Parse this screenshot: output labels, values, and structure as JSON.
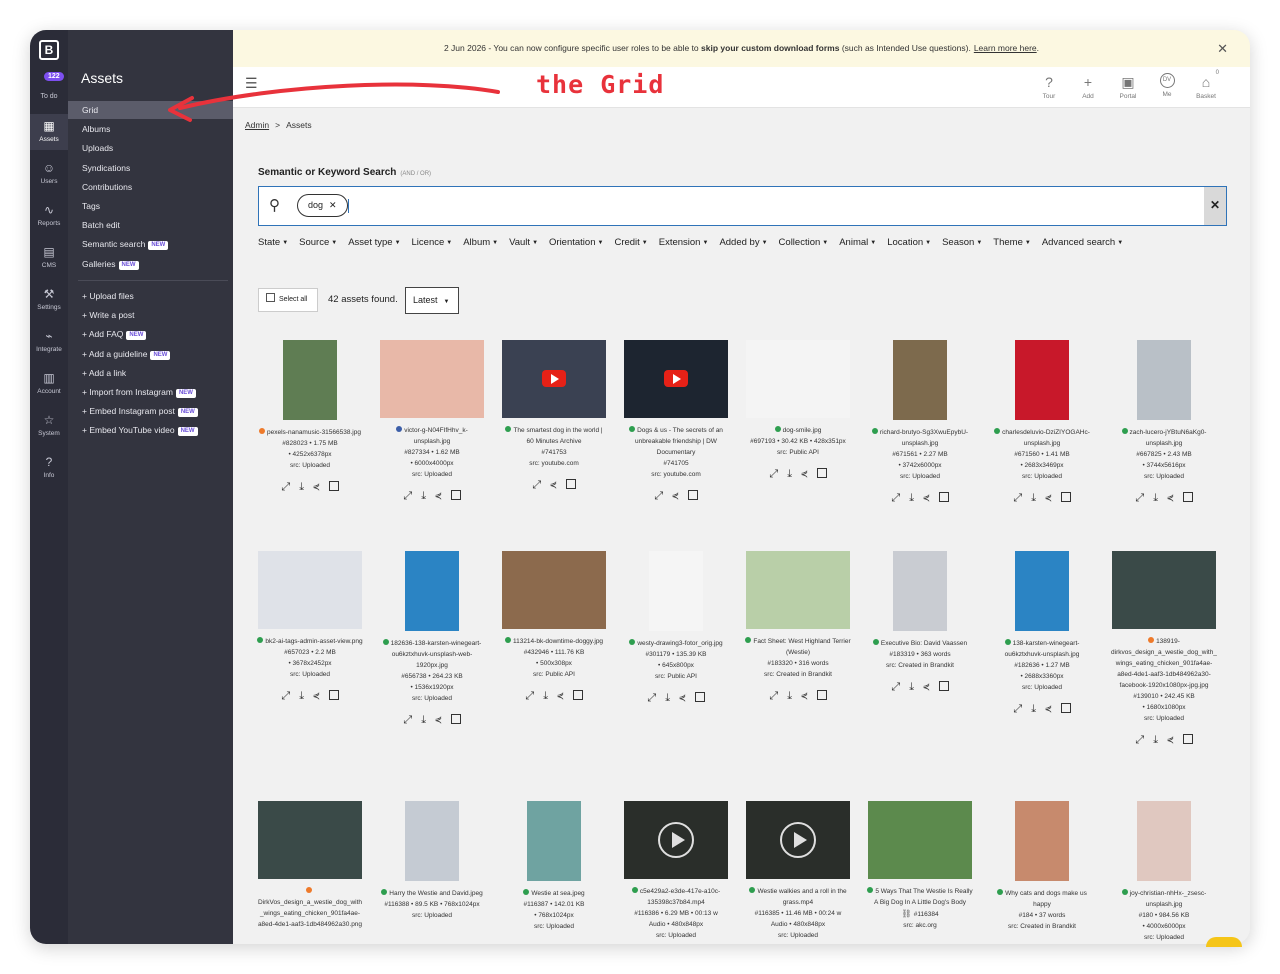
{
  "rail": {
    "logo": "B",
    "todo_count": "122",
    "todo_label": "To do",
    "items": [
      {
        "label": "Assets",
        "icon": "assets-icon",
        "glyph": "▦"
      },
      {
        "label": "Users",
        "icon": "users-icon",
        "glyph": "☺"
      },
      {
        "label": "Reports",
        "icon": "reports-icon",
        "glyph": "∿"
      },
      {
        "label": "CMS",
        "icon": "cms-icon",
        "glyph": "▤"
      },
      {
        "label": "Settings",
        "icon": "wrench-icon",
        "glyph": "⚒"
      },
      {
        "label": "Integrate",
        "icon": "plug-icon",
        "glyph": "⌁"
      },
      {
        "label": "Account",
        "icon": "building-icon",
        "glyph": "▥"
      },
      {
        "label": "System",
        "icon": "star-icon",
        "glyph": "☆"
      },
      {
        "label": "Info",
        "icon": "question-icon",
        "glyph": "?"
      }
    ]
  },
  "subnav": {
    "title": "Assets",
    "items": [
      {
        "label": "Grid"
      },
      {
        "label": "Albums"
      },
      {
        "label": "Uploads"
      },
      {
        "label": "Syndications"
      },
      {
        "label": "Contributions"
      },
      {
        "label": "Tags"
      },
      {
        "label": "Batch edit"
      },
      {
        "label": "Semantic search",
        "badge": "NEW"
      },
      {
        "label": "Galleries",
        "badge": "NEW"
      }
    ],
    "actions": [
      {
        "label": "+ Upload files"
      },
      {
        "label": "+ Write a post"
      },
      {
        "label": "+ Add FAQ",
        "badge": "NEW"
      },
      {
        "label": "+ Add a guideline",
        "badge": "NEW"
      },
      {
        "label": "+ Add a link"
      },
      {
        "label": "+ Import from Instagram",
        "badge": "NEW"
      },
      {
        "label": "+ Embed Instagram post",
        "badge": "NEW"
      },
      {
        "label": "+ Embed YouTube video",
        "badge": "NEW"
      }
    ]
  },
  "banner": {
    "prefix": "2 Jun 2026 - You can now configure specific user roles to be able to",
    "bold": "skip your custom download forms",
    "suffix": "(such as Intended Use questions).",
    "link": "Learn more here",
    "end": "."
  },
  "header": {
    "annotation": "the Grid",
    "icons": [
      {
        "label": "Tour",
        "glyph": "?"
      },
      {
        "label": "Add",
        "glyph": "+"
      },
      {
        "label": "Portal",
        "glyph": "▣"
      },
      {
        "label": "Me",
        "glyph": "DV"
      },
      {
        "label": "Basket",
        "glyph": "⌂",
        "count": "0"
      }
    ]
  },
  "breadcrumb": {
    "root": "Admin",
    "sep": ">",
    "current": "Assets"
  },
  "search": {
    "label": "Semantic or Keyword Search",
    "hint": "(AND / OR)",
    "chip": "dog"
  },
  "filters": [
    "State",
    "Source",
    "Asset type",
    "Licence",
    "Album",
    "Vault",
    "Orientation",
    "Credit",
    "Extension",
    "Added by",
    "Collection",
    "Animal",
    "Location",
    "Season",
    "Theme",
    "Advanced search"
  ],
  "toolbar": {
    "select_all": "Select all",
    "found": "42 assets found.",
    "sort": "Latest"
  },
  "colors": {
    "accent": "#2f73b8",
    "status_green": "#2e9e4f",
    "status_orange": "#ee7a2a",
    "status_blue": "#3c5ea8",
    "annotation_red": "#e8323b"
  },
  "assets": [
    {
      "status": "orange",
      "title": "pexels-nanamusic-31566538.jpg",
      "meta": [
        "#828023 • 1.75 MB",
        "• 4252x6378px",
        "src: Uploaded"
      ],
      "thumb": "tall",
      "bg": "#5f7d53"
    },
    {
      "status": "blue",
      "title": "victor-g-N04FIfHhv_k-unsplash.jpg",
      "meta": [
        "#827334 • 1.62 MB",
        "• 6000x4000px",
        "src: Uploaded"
      ],
      "thumb": "wide",
      "bg": "#e8b8a8"
    },
    {
      "status": "green",
      "title": "The smartest dog in the world | 60 Minutes Archive",
      "yt": "#741753",
      "meta": [
        "src: youtube.com"
      ],
      "thumb": "wide",
      "bg": "#3a4152",
      "video": "yt"
    },
    {
      "status": "green",
      "title": "Dogs & us - The secrets of an unbreakable friendship | DW Documentary",
      "yt": "#741705",
      "meta": [
        "src: youtube.com"
      ],
      "thumb": "wide",
      "bg": "#1d2530",
      "video": "yt"
    },
    {
      "status": "green",
      "title": "dog-smile.jpg",
      "meta": [
        "#697193 • 30.42 KB • 428x351px",
        "src: Public API"
      ],
      "thumb": "wide",
      "bg": "#f4f4f4"
    },
    {
      "status": "green",
      "title": "richard-brutyo-Sg3XwuEpybU-unsplash.jpg",
      "meta": [
        "#671561 • 2.27 MB",
        "• 3742x6000px",
        "src: Uploaded"
      ],
      "thumb": "tall",
      "bg": "#7d6a4d"
    },
    {
      "status": "green",
      "title": "charlesdeluvio-DziZIYOGAHc-unsplash.jpg",
      "meta": [
        "#671560 • 1.41 MB",
        "• 2683x3469px",
        "src: Uploaded"
      ],
      "thumb": "tall",
      "bg": "#c8182a"
    },
    {
      "status": "green",
      "title": "zach-lucero-jYBtuN6aKg0-unsplash.jpg",
      "meta": [
        "#667825 • 2.43 MB",
        "• 3744x5616px",
        "src: Uploaded"
      ],
      "thumb": "tall",
      "bg": "#b9c0c7"
    },
    {
      "status": "green",
      "title": "bk2-ai-tags-admin-asset-view.png",
      "meta": [
        "#657023 • 2.2 MB",
        "• 3678x2452px",
        "src: Uploaded"
      ],
      "thumb": "wide",
      "bg": "#dfe2e8"
    },
    {
      "status": "green",
      "title": "182636-138-karsten-winegeart-ou6kztxhuvk-unsplash-web-1920px.jpg",
      "meta": [
        "#656738 • 264.23 KB",
        "• 1536x1920px",
        "src: Uploaded"
      ],
      "thumb": "tall",
      "bg": "#2b84c4"
    },
    {
      "status": "green",
      "title": "113214-bk-downtime-doggy.jpg",
      "meta": [
        "#432946 • 111.76 KB",
        "• 500x308px",
        "src: Public API"
      ],
      "thumb": "wide",
      "bg": "#8c6a4d"
    },
    {
      "status": "green",
      "title": "westy-drawing3-fotor_orig.jpg",
      "meta": [
        "#301179 • 135.39 KB",
        "• 645x800px",
        "src: Public API"
      ],
      "thumb": "tall",
      "bg": "#f5f5f5"
    },
    {
      "status": "green",
      "title": "Fact Sheet: West Highland Terrier (Westie)",
      "meta": [
        "#183320 • 316 words",
        "src: Created in Brandkit"
      ],
      "thumb": "wide",
      "bg": "#b9cfa8"
    },
    {
      "status": "green",
      "title": "Executive Bio: David Vaassen",
      "meta": [
        "#183319 • 363 words",
        "src: Created in Brandkit"
      ],
      "thumb": "tall",
      "bg": "#c9ccd2"
    },
    {
      "status": "green",
      "title": "138-karsten-winegeart-ou6kztxhuvk-unsplash.jpg",
      "meta": [
        "#182636 • 1.27 MB",
        "• 2688x3360px",
        "src: Uploaded"
      ],
      "thumb": "tall",
      "bg": "#2b84c4"
    },
    {
      "status": "orange",
      "title": "138919-dirkvos_design_a_westie_dog_with_wings_eating_chicken_901fa4ae-a8ed-4de1-aaf3-1db484962a30-facebook-1920x1080px-jpg.jpg",
      "meta": [
        "#139010 • 242.45 KB",
        "• 1680x1080px",
        "src: Uploaded"
      ],
      "thumb": "wide",
      "bg": "#3a4a48"
    },
    {
      "status": "orange",
      "title": "DirkVos_design_a_westie_dog_with_wings_eating_chicken_901fa4ae-a8ed-4de1-aaf3-1db484962a30.png",
      "meta": [],
      "thumb": "wide",
      "bg": "#3a4a48",
      "dot_on_own_line": true
    },
    {
      "status": "green",
      "title": "Harry the Westie and David.jpeg",
      "meta": [
        "#116388 • 89.5 KB • 768x1024px",
        "src: Uploaded"
      ],
      "thumb": "tall",
      "bg": "#c5cbd3"
    },
    {
      "status": "green",
      "title": "Westie at sea.jpeg",
      "meta": [
        "#116387 • 142.01 KB",
        "• 768x1024px",
        "src: Uploaded"
      ],
      "thumb": "tall",
      "bg": "#6fa3a1"
    },
    {
      "status": "green",
      "title": "c5e429a2-e3de-417e-a10c-135398c37b84.mp4",
      "meta": [
        "#116386 • 6.29 MB • 00:13 w",
        "Audio • 480x848px",
        "src: Uploaded"
      ],
      "thumb": "wide",
      "bg": "#2a2e2a",
      "video": "ring"
    },
    {
      "status": "green",
      "title": "Westie walkies and a roll in the grass.mp4",
      "meta": [
        "#116385 • 11.46 MB • 00:24 w",
        "Audio • 480x848px",
        "src: Uploaded"
      ],
      "thumb": "wide",
      "bg": "#2a2e2a",
      "video": "ring"
    },
    {
      "status": "green",
      "title": "5 Ways That The Westie Is Really A Big Dog In A Little Dog's Body",
      "tag": "#116384",
      "meta": [
        "src: akc.org"
      ],
      "thumb": "wide",
      "bg": "#5c8a4d"
    },
    {
      "status": "green",
      "title": "Why cats and dogs make us happy",
      "meta": [
        "#184 • 37 words",
        "src: Created in Brandkit"
      ],
      "thumb": "tall",
      "bg": "#c78a6d"
    },
    {
      "status": "green",
      "title": "joy-christian-nhHx-_zsesc-unsplash.jpg",
      "meta": [
        "#180 • 984.56 KB",
        "• 4000x6000px",
        "src: Uploaded"
      ],
      "thumb": "tall",
      "bg": "#e0c8c0"
    }
  ],
  "actions_labels": {
    "expand": "⤢",
    "download": "⤓",
    "share": "⋞"
  }
}
